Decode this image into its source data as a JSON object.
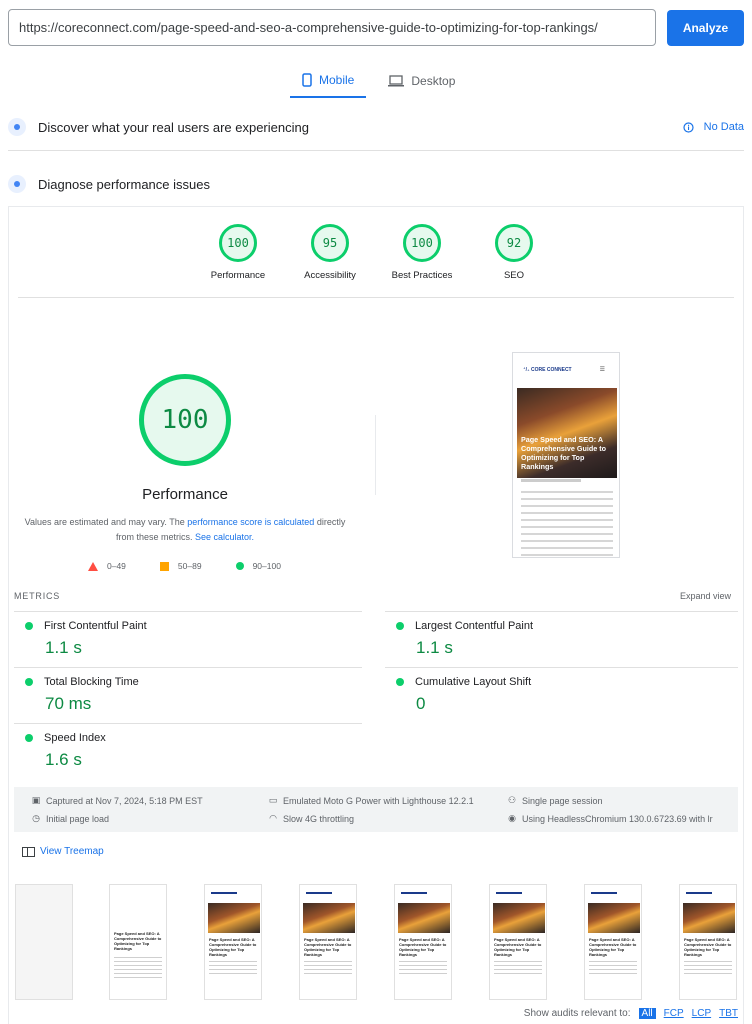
{
  "url_bar": {
    "value": "https://coreconnect.com/page-speed-and-seo-a-comprehensive-guide-to-optimizing-for-top-rankings/"
  },
  "analyze_label": "Analyze",
  "tabs": [
    {
      "label": "Mobile",
      "icon": "phone-icon",
      "active": true
    },
    {
      "label": "Desktop",
      "icon": "laptop-icon",
      "active": false
    }
  ],
  "field_data": {
    "title": "Discover what your real users are experiencing",
    "status": "No Data"
  },
  "diagnose": {
    "title": "Diagnose performance issues"
  },
  "scores": [
    {
      "value": "100",
      "label": "Performance"
    },
    {
      "value": "95",
      "label": "Accessibility"
    },
    {
      "value": "100",
      "label": "Best Practices"
    },
    {
      "value": "92",
      "label": "SEO"
    }
  ],
  "performance": {
    "score": "100",
    "title": "Performance",
    "note_pre": "Values are estimated and may vary. The ",
    "note_link1": "performance score is calculated",
    "note_mid": " directly from these metrics. ",
    "note_link2": "See calculator.",
    "legend": [
      {
        "range": "0–49",
        "color": "#ff4e42"
      },
      {
        "range": "50–89",
        "color": "#ffa400"
      },
      {
        "range": "90–100",
        "color": "#0cce6b"
      }
    ]
  },
  "preview": {
    "brand": "⁺/₊ CORE CONNECT",
    "title": "Page Speed and SEO: A Comprehensive Guide to Optimizing for Top Rankings"
  },
  "metrics": {
    "label": "METRICS",
    "expand": "Expand view",
    "items": [
      {
        "name": "First Contentful Paint",
        "value": "1.1 s"
      },
      {
        "name": "Largest Contentful Paint",
        "value": "1.1 s"
      },
      {
        "name": "Total Blocking Time",
        "value": "70 ms"
      },
      {
        "name": "Cumulative Layout Shift",
        "value": "0"
      },
      {
        "name": "Speed Index",
        "value": "1.6 s"
      }
    ]
  },
  "info": {
    "captured": "Captured at Nov 7, 2024, 5:18 PM EST",
    "load": "Initial page load",
    "device": "Emulated Moto G Power with Lighthouse 12.2.1",
    "throttling": "Slow 4G throttling",
    "session": "Single page session",
    "browser": "Using HeadlessChromium 130.0.6723.69 with lr"
  },
  "treemap_label": "View Treemap",
  "thumb_title": "Page Speed and SEO: A Comprehensive Guide to Optimizing for Top Rankings",
  "relevant": {
    "label": "Show audits relevant to:",
    "chips": [
      "All",
      "FCP",
      "LCP",
      "TBT"
    ]
  },
  "colors": {
    "accent": "#1a73e8",
    "pass": "#0cce6b",
    "pass_text": "#0d8a43"
  }
}
